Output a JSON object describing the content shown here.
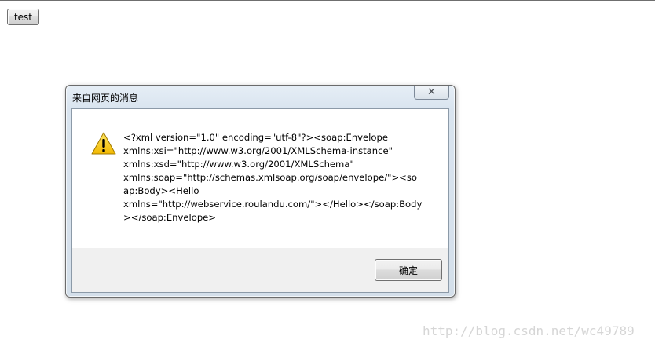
{
  "page": {
    "test_button_label": "test"
  },
  "dialog": {
    "title": "来自网页的消息",
    "close_symbol": "✕",
    "icon": "warning-icon",
    "message_lines": [
      "<?xml version=\"1.0\" encoding=\"utf-8\"?><soap:Envelope",
      "xmlns:xsi=\"http://www.w3.org/2001/XMLSchema-instance\"",
      "xmlns:xsd=\"http://www.w3.org/2001/XMLSchema\"",
      "xmlns:soap=\"http://schemas.xmlsoap.org/soap/envelope/\"><so",
      "ap:Body><Hello",
      "xmlns=\"http://webservice.roulandu.com/\"></Hello></soap:Body",
      "></soap:Envelope>"
    ],
    "ok_button_label": "确定"
  },
  "watermark": "http://blog.csdn.net/wc49789",
  "colors": {
    "warning_yellow": "#f5c400",
    "dialog_frame": "#d4dfea",
    "button_strip": "#f0f0f0"
  }
}
